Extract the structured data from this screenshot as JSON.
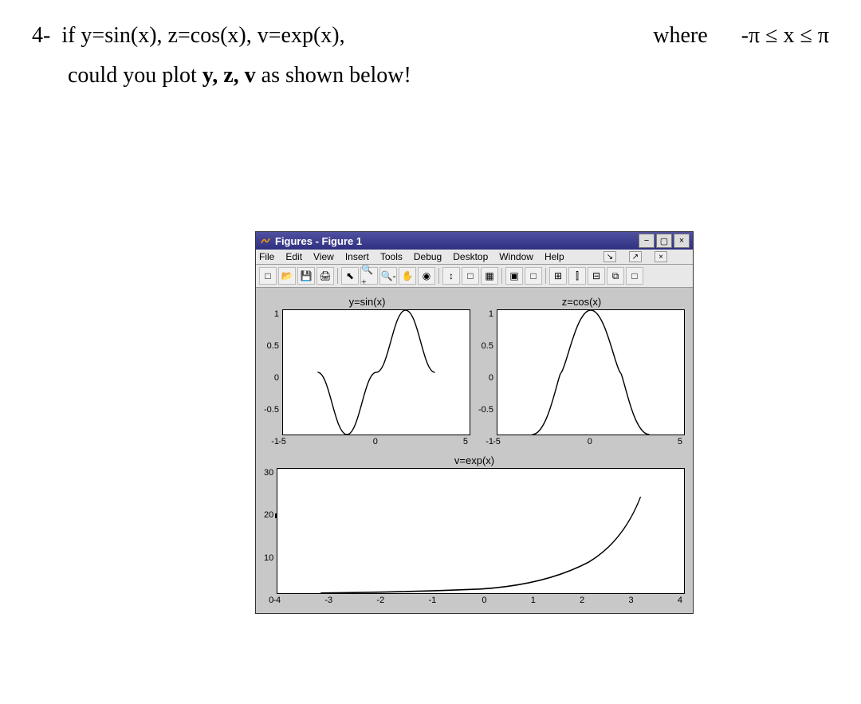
{
  "question": {
    "number": "4-",
    "text_left": "if y=sin(x), z=cos(x), v=exp(x),",
    "text_right": "where",
    "range": "-π ≤ x ≤ π",
    "line2_a": "could you plot ",
    "line2_b": "y, z, v",
    "line2_c": " as shown below!"
  },
  "window": {
    "title": "Figures - Figure 1",
    "min_label": "−",
    "restore_label": "▢",
    "close_label": "×"
  },
  "menu": {
    "items": [
      "File",
      "Edit",
      "View",
      "Insert",
      "Tools",
      "Debug",
      "Desktop",
      "Window",
      "Help"
    ],
    "right_btn1": "↘",
    "right_btn2": "↗",
    "right_btn3": "×"
  },
  "toolbar_icons": [
    "□",
    "📂",
    "💾",
    "🖨",
    "⬉",
    "🔍+",
    "🔍-",
    "✋",
    "◉",
    "↕",
    "□",
    "▦",
    "▣",
    "□",
    "⊞",
    "⫿",
    "⊟",
    "⧉",
    "□"
  ],
  "chart_data": [
    {
      "title": "y=sin(x)",
      "type": "line",
      "xlim": [
        -5,
        5
      ],
      "ylim": [
        -1,
        1
      ],
      "xticks": [
        "-5",
        "0",
        "5"
      ],
      "yticks": [
        "1",
        "0.5",
        "0",
        "-0.5",
        "-1"
      ]
    },
    {
      "title": "z=cos(x)",
      "type": "line",
      "xlim": [
        -5,
        5
      ],
      "ylim": [
        -1,
        1
      ],
      "xticks": [
        "-5",
        "0",
        "5"
      ],
      "yticks": [
        "1",
        "0.5",
        "0",
        "-0.5",
        "-1"
      ]
    },
    {
      "title": "v=exp(x)",
      "type": "line",
      "xlim": [
        -4,
        4
      ],
      "ylim": [
        0,
        30
      ],
      "xticks": [
        "-4",
        "-3",
        "-2",
        "-1",
        "0",
        "1",
        "2",
        "3",
        "4"
      ],
      "yticks": [
        "30",
        "20",
        "10",
        "0"
      ]
    }
  ]
}
